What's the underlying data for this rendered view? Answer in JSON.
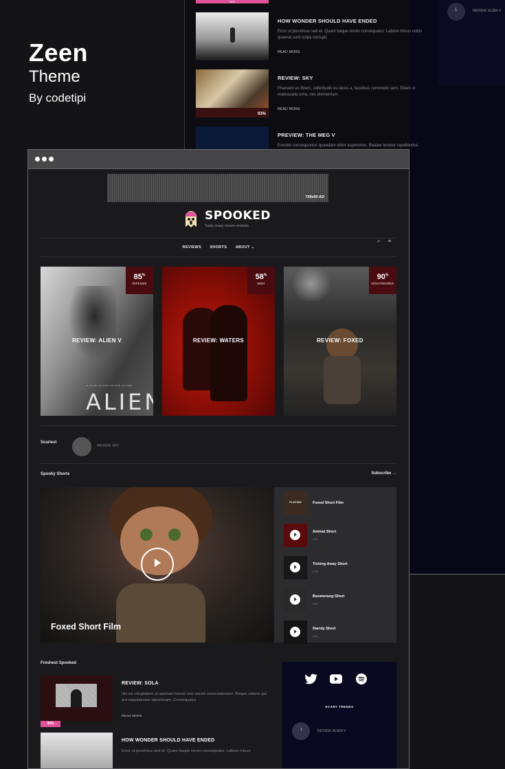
{
  "brand": {
    "title": "Zeen",
    "subtitle": "Theme",
    "byline": "By codetipi"
  },
  "background": {
    "items": [
      {
        "title": "HOW WONDER SHOULD HAVE ENDED",
        "excerpt": "Error ut possimus sed et. Quam itaque rerum consequatur. Labore minus nobis quaerat sunt culpa corrupti.",
        "more": "READ MORE"
      },
      {
        "title": "REVIEW: SKY",
        "excerpt": "Praesent ex libero, sollicitudin eu lacus a, faucibus commodo sem. Etiam ut malesuada urna, nec elementum.",
        "more": "READ MORE",
        "pct": "93%"
      },
      {
        "title": "PREVIEW: THE MEG V",
        "excerpt": "Eveniet consequuntur quaedam dolor asperiores. Beatae tenetur repellendus"
      }
    ],
    "top_badge": "36%",
    "trend_item": "REVIEW: ALIEN V",
    "trend_num": "1"
  },
  "site": {
    "ad_label": "728x90 AD",
    "logo": "SPOOKED",
    "tagline": "Tasty scary movie reviews",
    "nav": [
      "REVIEWS",
      "SHORTS",
      "ABOUT ⌄"
    ],
    "search_icon": "search-icon",
    "menu_icon": "menu-icon",
    "cards": [
      {
        "title": "REVIEW: ALIEN V",
        "score": "85",
        "unit": "%",
        "label": "INTENSE",
        "poster": "ALIEN"
      },
      {
        "title": "REVIEW: WATERS",
        "score": "58",
        "unit": "%",
        "label": "MEH"
      },
      {
        "title": "REVIEW: FOXED",
        "score": "90",
        "unit": "%",
        "label": "NIGHTMARES"
      }
    ],
    "scariest_label": "Scariest",
    "scariest_item": "REVIEW: SKY",
    "shorts_label": "Spooky Shorts",
    "subscribe": "Subscribe →",
    "video_title": "Foxed Short Film",
    "playlist": [
      {
        "name": "Foxed Short Film",
        "playing": "PLAYING"
      },
      {
        "name": "Animal Short",
        "dur": "4:00"
      },
      {
        "name": "Ticking Away Short",
        "dur": "3:26"
      },
      {
        "name": "Boomerang Short",
        "dur": "3:40"
      },
      {
        "name": "Harrdy Short",
        "dur": "4:01"
      }
    ],
    "fresh_label": "Freshest Spooked",
    "fresh": [
      {
        "title": "REVIEW: SOLA",
        "excerpt": "Hic ea voluptatem ut aperiam harum non earum exercitationem. Neque ratione qui aut repudiandae laboriosam. Consequatur.",
        "more": "READ MORE",
        "pct": "30%"
      },
      {
        "title": "HOW WONDER SHOULD HAVE ENDED",
        "excerpt": "Error ut possimus sed et. Quam itaque rerum consequatur. Labore minus"
      }
    ],
    "social": {
      "trends_label": "SCARY TRENDS",
      "trend_item": "REVIEW: ALIEN V",
      "trend_num": "1"
    }
  },
  "colors": {
    "accent": "#e0529b",
    "badge": "#4a0b10",
    "dark_panel": "#080820"
  }
}
